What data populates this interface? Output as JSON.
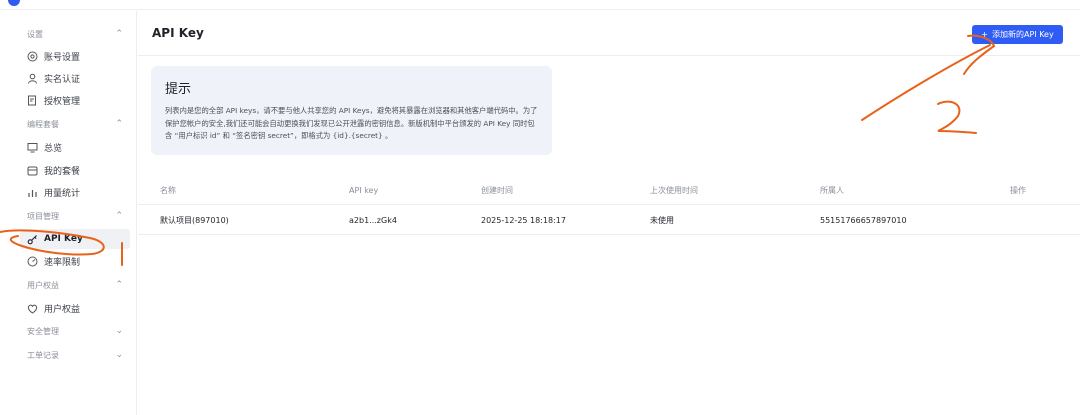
{
  "sidebar": {
    "groups": [
      {
        "label": "设置",
        "items": [
          "账号设置",
          "实名认证",
          "授权管理"
        ]
      },
      {
        "label": "编程套餐",
        "items": [
          "总览",
          "我的套餐",
          "用量统计"
        ]
      },
      {
        "label": "项目管理",
        "items": [
          "API Key",
          "速率限制"
        ]
      },
      {
        "label": "用户权益",
        "items": [
          "用户权益"
        ]
      },
      {
        "label": "安全管理",
        "items": []
      },
      {
        "label": "工单记录",
        "items": []
      }
    ],
    "active_item": "API Key"
  },
  "header": {
    "title": "API Key",
    "add_button_label": "添加新的API Key"
  },
  "notice": {
    "title": "提示",
    "body": "列表内是您的全部 API keys，请不要与他人共享您的 API Keys，避免将其暴露在浏览器和其他客户端代码中。为了保护您帐户的安全,我们还可能会自动更换我们发现已公开泄露的密钥信息。新版机制中平台颁发的 API Key 同时包含 “用户标识 id” 和 “签名密钥 secret”，即格式为 {id}.{secret} 。"
  },
  "table": {
    "columns": [
      "名称",
      "API key",
      "创建时间",
      "上次使用时间",
      "所属人",
      "操作"
    ],
    "rows": [
      [
        "默认项目(897010)",
        "a2b1...zGk4",
        "2025-12-25 18:18:17",
        "未使用",
        "55151766657897010",
        ""
      ]
    ]
  },
  "annotations": {
    "mark_1": "1",
    "mark_2": "2",
    "color": "#e8621a"
  },
  "colors": {
    "primary": "#2f5cf5",
    "notice_bg": "#eff2f8",
    "active_bg": "#f0f1f4"
  }
}
